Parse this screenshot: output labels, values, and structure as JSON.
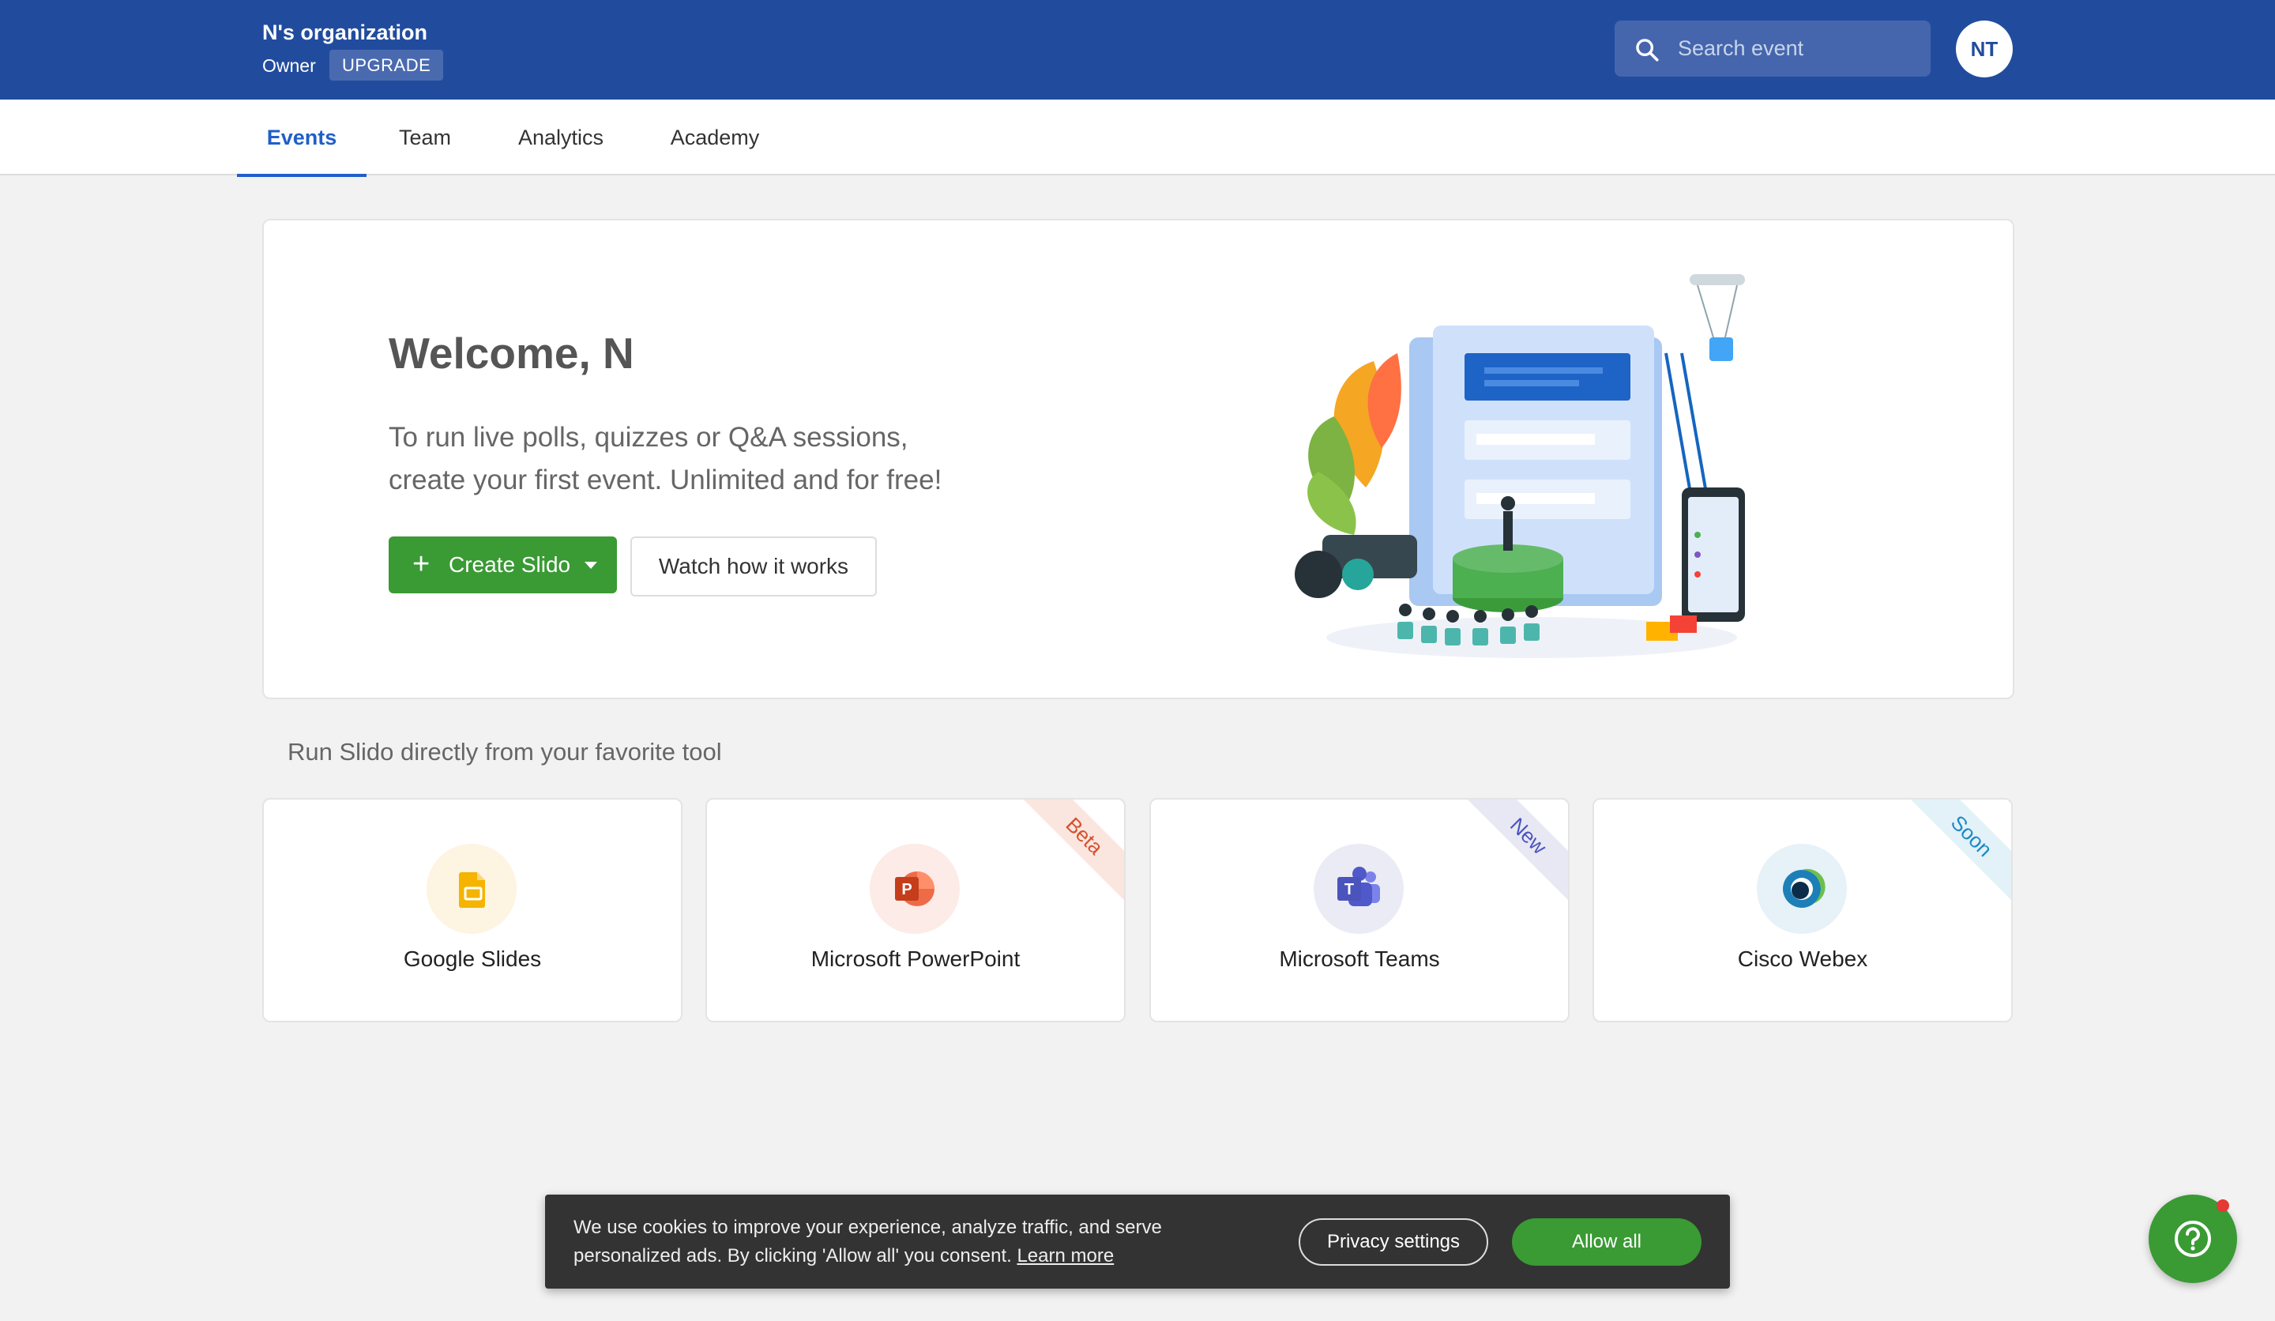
{
  "header": {
    "org_name": "N's organization",
    "role": "Owner",
    "upgrade_label": "UPGRADE",
    "search_placeholder": "Search event",
    "avatar_initials": "NT"
  },
  "nav": {
    "tabs": [
      {
        "label": "Events",
        "active": true
      },
      {
        "label": "Team",
        "active": false
      },
      {
        "label": "Analytics",
        "active": false
      },
      {
        "label": "Academy",
        "active": false
      }
    ]
  },
  "welcome": {
    "title": "Welcome, N",
    "line1": "To run live polls, quizzes or Q&A sessions,",
    "line2": "create your first event. Unlimited and for free!",
    "create_label": "Create Slido",
    "watch_label": "Watch how it works"
  },
  "integrations": {
    "title": "Run Slido directly from your favorite tool",
    "cards": [
      {
        "name": "Google Slides",
        "icon": "google-slides-icon",
        "ribbon": ""
      },
      {
        "name": "Microsoft PowerPoint",
        "icon": "powerpoint-icon",
        "ribbon": "Beta"
      },
      {
        "name": "Microsoft Teams",
        "icon": "teams-icon",
        "ribbon": "New"
      },
      {
        "name": "Cisco Webex",
        "icon": "webex-icon",
        "ribbon": "Soon"
      }
    ]
  },
  "cookie": {
    "text": "We use cookies to improve your experience, analyze traffic, and serve personalized ads. By clicking 'Allow all' you consent.",
    "learn_more": "Learn more",
    "privacy_label": "Privacy settings",
    "allow_label": "Allow all"
  },
  "colors": {
    "header_bg": "#214c9e",
    "accent_blue": "#1f5fc8",
    "primary_green": "#3a9a34"
  }
}
